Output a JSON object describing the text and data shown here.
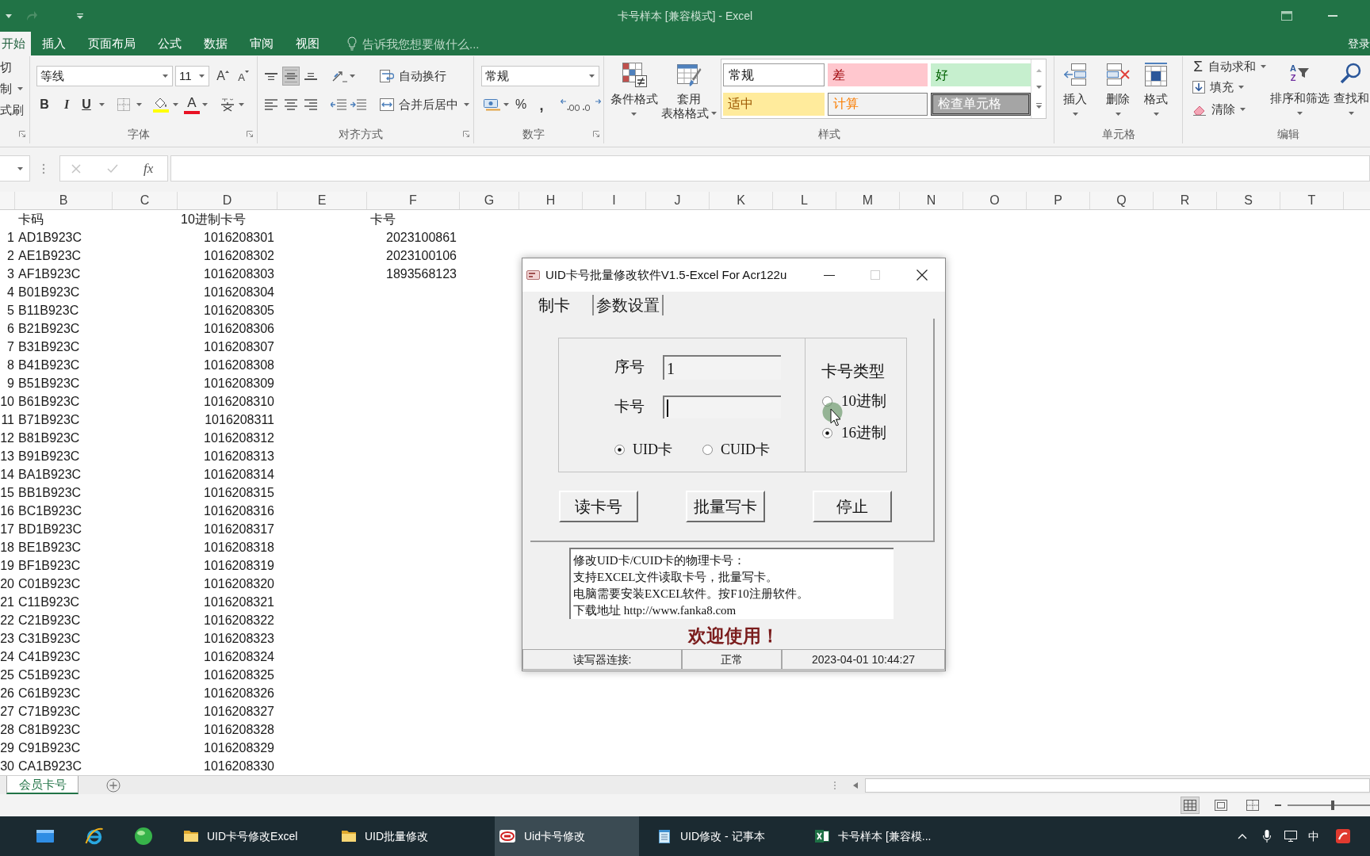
{
  "window": {
    "title": "卡号样本 [兼容模式] - Excel",
    "sign_in": "登录"
  },
  "ribbon_tabs": [
    {
      "label": "开始",
      "selected": true
    },
    {
      "label": "插入",
      "selected": false
    },
    {
      "label": "页面布局",
      "selected": false
    },
    {
      "label": "公式",
      "selected": false
    },
    {
      "label": "数据",
      "selected": false
    },
    {
      "label": "审阅",
      "selected": false
    },
    {
      "label": "视图",
      "selected": false
    }
  ],
  "tell_me": {
    "placeholder": "告诉我您想要做什么..."
  },
  "ribbon": {
    "clipboard": {
      "items": [
        {
          "label": "切",
          "dropdown": false
        },
        {
          "label": "制",
          "dropdown": true
        },
        {
          "label": "式刷",
          "dropdown": false
        }
      ]
    },
    "font": {
      "name": "等线",
      "size": "11",
      "grow": "A",
      "shrink": "A",
      "bold": "B",
      "italic": "I",
      "underline": "U",
      "font_color": "A",
      "label": "字体"
    },
    "alignment": {
      "vertical": [
        {
          "kind": "top",
          "selected": false
        },
        {
          "kind": "middle",
          "selected": true
        },
        {
          "kind": "bottom",
          "selected": false
        }
      ],
      "horizontal": [
        {
          "kind": "left",
          "selected": false
        },
        {
          "kind": "center",
          "selected": false
        },
        {
          "kind": "right",
          "selected": false
        }
      ],
      "wrap_text": "自动换行",
      "merge_center": "合并后居中",
      "label": "对齐方式"
    },
    "number": {
      "format": "常规",
      "percent": "%",
      "comma": ",",
      "label": "数字"
    },
    "styles": {
      "conditional": "条件格式",
      "table_format": [
        "套用",
        "表格格式"
      ],
      "gallery": [
        {
          "label": "常规",
          "kind": "normal"
        },
        {
          "label": "差",
          "kind": "bad"
        },
        {
          "label": "好",
          "kind": "good"
        },
        {
          "label": "适中",
          "kind": "neutral"
        },
        {
          "label": "计算",
          "kind": "calculation"
        },
        {
          "label": "检查单元格",
          "kind": "check"
        }
      ],
      "label": "样式"
    },
    "cells": {
      "buttons": [
        {
          "label": "插入",
          "kind": "insert"
        },
        {
          "label": "删除",
          "kind": "delete"
        },
        {
          "label": "格式",
          "kind": "format"
        }
      ],
      "label": "单元格"
    },
    "editing": {
      "items": [
        {
          "label": "自动求和",
          "kind": "autosum",
          "glyph": "Σ"
        },
        {
          "label": "填充",
          "kind": "fill"
        },
        {
          "label": "清除",
          "kind": "clear"
        }
      ],
      "sort": {
        "label": "排序和筛选",
        "letters": [
          "A",
          "Z"
        ]
      },
      "find": {
        "label": "查找和"
      },
      "label": "编辑"
    }
  },
  "formula_bar": {
    "fx": "fx"
  },
  "sheet": {
    "columns": [
      "B",
      "C",
      "D",
      "E",
      "F",
      "G",
      "H",
      "I",
      "J",
      "K",
      "L",
      "M",
      "N",
      "O",
      "P",
      "Q",
      "R",
      "S",
      "T"
    ],
    "rows": [
      {
        "kind": "header",
        "b": "卡码",
        "d": "10进制卡号",
        "f": "卡号"
      },
      {
        "kind": "data",
        "a": "1",
        "b": "AD1B923C",
        "d": "1016208301",
        "f": "2023100861"
      },
      {
        "kind": "data",
        "a": "2",
        "b": "AE1B923C",
        "d": "1016208302",
        "f": "2023100106"
      },
      {
        "kind": "data",
        "a": "3",
        "b": "AF1B923C",
        "d": "1016208303",
        "f": "1893568123"
      },
      {
        "kind": "data",
        "a": "4",
        "b": "B01B923C",
        "d": "1016208304"
      },
      {
        "kind": "data",
        "a": "5",
        "b": "B11B923C",
        "d": "1016208305"
      },
      {
        "kind": "data",
        "a": "6",
        "b": "B21B923C",
        "d": "1016208306"
      },
      {
        "kind": "data",
        "a": "7",
        "b": "B31B923C",
        "d": "1016208307"
      },
      {
        "kind": "data",
        "a": "8",
        "b": "B41B923C",
        "d": "1016208308"
      },
      {
        "kind": "data",
        "a": "9",
        "b": "B51B923C",
        "d": "1016208309"
      },
      {
        "kind": "data",
        "a": "10",
        "b": "B61B923C",
        "d": "1016208310"
      },
      {
        "kind": "data",
        "a": "11",
        "b": "B71B923C",
        "d": "1016208311"
      },
      {
        "kind": "data",
        "a": "12",
        "b": "B81B923C",
        "d": "1016208312"
      },
      {
        "kind": "data",
        "a": "13",
        "b": "B91B923C",
        "d": "1016208313"
      },
      {
        "kind": "data",
        "a": "14",
        "b": "BA1B923C",
        "d": "1016208314"
      },
      {
        "kind": "data",
        "a": "15",
        "b": "BB1B923C",
        "d": "1016208315"
      },
      {
        "kind": "data",
        "a": "16",
        "b": "BC1B923C",
        "d": "1016208316"
      },
      {
        "kind": "data",
        "a": "17",
        "b": "BD1B923C",
        "d": "1016208317"
      },
      {
        "kind": "data",
        "a": "18",
        "b": "BE1B923C",
        "d": "1016208318"
      },
      {
        "kind": "data",
        "a": "19",
        "b": "BF1B923C",
        "d": "1016208319"
      },
      {
        "kind": "data",
        "a": "20",
        "b": "C01B923C",
        "d": "1016208320"
      },
      {
        "kind": "data",
        "a": "21",
        "b": "C11B923C",
        "d": "1016208321"
      },
      {
        "kind": "data",
        "a": "22",
        "b": "C21B923C",
        "d": "1016208322"
      },
      {
        "kind": "data",
        "a": "23",
        "b": "C31B923C",
        "d": "1016208323"
      },
      {
        "kind": "data",
        "a": "24",
        "b": "C41B923C",
        "d": "1016208324"
      },
      {
        "kind": "data",
        "a": "25",
        "b": "C51B923C",
        "d": "1016208325"
      },
      {
        "kind": "data",
        "a": "26",
        "b": "C61B923C",
        "d": "1016208326"
      },
      {
        "kind": "data",
        "a": "27",
        "b": "C71B923C",
        "d": "1016208327"
      },
      {
        "kind": "data",
        "a": "28",
        "b": "C81B923C",
        "d": "1016208328"
      },
      {
        "kind": "data",
        "a": "29",
        "b": "C91B923C",
        "d": "1016208329"
      },
      {
        "kind": "data",
        "a": "30",
        "b": "CA1B923C",
        "d": "1016208330"
      }
    ]
  },
  "sheet_tabs": [
    {
      "label": "会员卡号",
      "selected": true
    }
  ],
  "status_bar": {
    "views": [
      {
        "kind": "normal",
        "selected": true
      },
      {
        "kind": "page_layout",
        "selected": false
      },
      {
        "kind": "page_break",
        "selected": false
      }
    ],
    "zoom": {
      "level": 0.55
    }
  },
  "dialog": {
    "title": "UID卡号批量修改软件V1.5-Excel For Acr122u",
    "tabs": [
      {
        "label": "制卡",
        "selected": true
      },
      {
        "label": "参数设置",
        "selected": false
      }
    ],
    "fields": [
      {
        "label": "序号",
        "value": "1",
        "focused": false
      },
      {
        "label": "卡号",
        "focused": true
      }
    ],
    "card_types": [
      {
        "label": "UID卡",
        "selected": true
      },
      {
        "label": "CUID卡",
        "selected": false
      }
    ],
    "number_type": {
      "label": "卡号类型",
      "options": [
        {
          "label": "10进制",
          "selected": false
        },
        {
          "label": "16进制",
          "selected": true
        }
      ]
    },
    "buttons": [
      "读卡号",
      "批量写卡",
      "停止"
    ],
    "info_lines": [
      "修改UID卡/CUID卡的物理卡号：",
      "支持EXCEL文件读取卡号，批量写卡。",
      "电脑需要安装EXCEL软件。按F10注册软件。",
      "下载地址 http://www.fanka8.com"
    ],
    "welcome": "欢迎使用！",
    "status": [
      "读写器连接:",
      "正常",
      "2023-04-01 10:44:27"
    ]
  },
  "taskbar": {
    "items": [
      {
        "label": "UID卡号修改Excel",
        "kind": "folder",
        "selected": false
      },
      {
        "label": "UID批量修改",
        "kind": "folder",
        "selected": false
      },
      {
        "label": "Uid卡号修改",
        "kind": "app",
        "selected": true
      },
      {
        "label": "UID修改 - 记事本",
        "kind": "notepad",
        "selected": false
      },
      {
        "label": "卡号样本 [兼容模...",
        "kind": "excel",
        "selected": false
      }
    ],
    "tray": {
      "ime": "中"
    }
  }
}
